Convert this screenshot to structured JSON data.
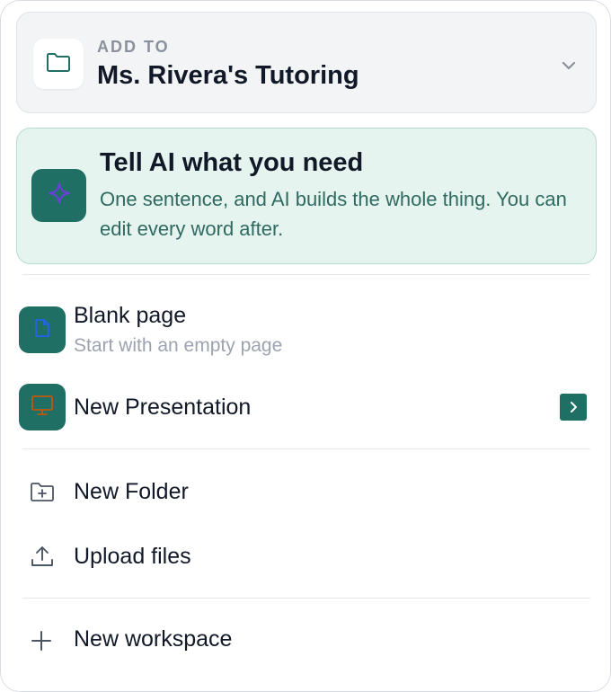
{
  "workspace_select": {
    "kicker": "ADD TO",
    "name": "Ms. Rivera's Tutoring",
    "icon": "folder-icon",
    "chevron_icon": "chevron-down-icon"
  },
  "ai_card": {
    "title": "Tell AI what you need",
    "description": "One sentence, and AI builds the whole thing. You can edit every word after.",
    "icon": "sparkle-icon"
  },
  "create_items": [
    {
      "label": "Blank page",
      "sublabel": "Start with an empty page",
      "icon": "document-icon"
    },
    {
      "label": "New Presentation",
      "icon": "monitor-icon",
      "submenu_icon": "chevron-right-icon"
    }
  ],
  "file_items": [
    {
      "label": "New Folder",
      "icon": "folder-plus-icon"
    },
    {
      "label": "Upload files",
      "icon": "upload-icon"
    }
  ],
  "workspace_items": [
    {
      "label": "New workspace",
      "icon": "plus-icon"
    }
  ],
  "colors": {
    "accent": "#1f6f65",
    "ai_card_background": "#e6f4f0",
    "ai_card_border": "#b5dccf",
    "ai_description": "#2f6a60",
    "sparkle": "#6b3fd8",
    "document_icon": "#2563eb",
    "monitor_icon": "#c2570c"
  }
}
